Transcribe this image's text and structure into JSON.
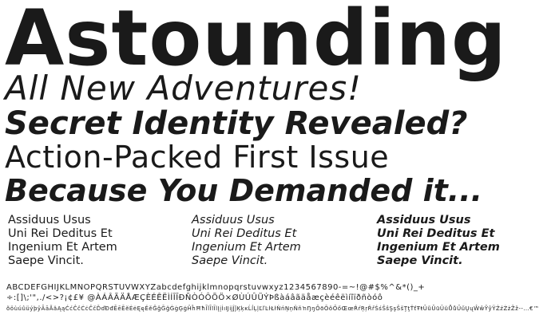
{
  "specimen": {
    "headline": "Astounding",
    "lines": [
      "All New Adventures!",
      "Secret Identity Revealed?",
      "Action-Packed First Issue",
      "Because You Demanded it..."
    ],
    "paragraph_lines": [
      "Assiduus Usus",
      "Uni Rei Deditus Et",
      "Ingenium Et Artem",
      "Saepe Vincit."
    ],
    "glyph_rows": [
      "ABCDEFGHIJKLMNOPQRSTUVWXYZabcdefghijklmnopqrstuvwxyz1234567890-=~!@#$%^&*()_+",
      "÷:[]\\;'\",./<>?¡¢£¥ @ÀÁÂÃÄÅÆÇÈÉÊËÌÍÎÏÐÑÒÓÔÕÖ×ØÙÚÛÜÝÞßàáâãäåæçèéêëìíîïðñòóô",
      "õöùúûüýþÿĀāĂăĄąĆćĈĉĊċČčĎďĐđĒēĔĕĖėĘęĚěĜĝĞğĠġĢģĤĥĦħĨĩĪīĬĭĮįİıĲĳĴĵĶķĸĹĺĻļĽľĿŀŁłŃńŅņŇňŉŊŋŌōŎŏŐőŒœŔŕŖŗŘřŚśŜŝŞşŠšŢţŤťŦŧŨũŪūŬŭŮůŰűŲųŴŵŶŷŸŹźŻżŽž--…€™"
    ]
  }
}
